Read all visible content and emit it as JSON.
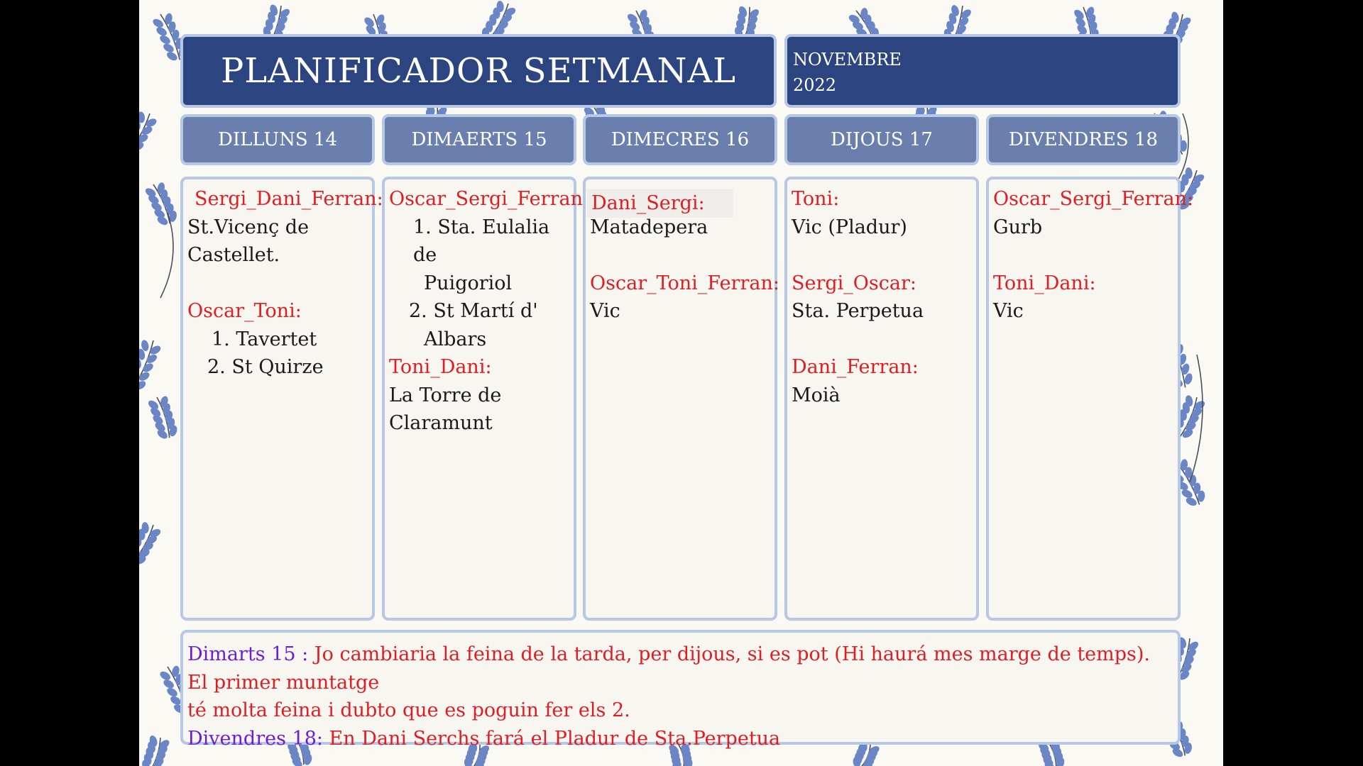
{
  "header": {
    "title": "PLANIFICADOR SETMANAL",
    "month": "NOVEMBRE",
    "year": "2022"
  },
  "days": [
    {
      "label": "DILLUNS 14"
    },
    {
      "label": "DIMAERTS 15"
    },
    {
      "label": "DIMECRES 16"
    },
    {
      "label": "DIJOUS 17"
    },
    {
      "label": "DIVENDRES 18"
    }
  ],
  "schedule": {
    "mon": {
      "g1": "Sergi_Dani_Ferran:",
      "g1_l1": "St.Vicenç de",
      "g1_l2": "Castellet.",
      "g2": "Oscar_Toni:",
      "g2_i1": "1. Tavertet",
      "g2_i2": "2. St Quirze"
    },
    "tue": {
      "g1": "Oscar_Sergi_Ferran:",
      "g1_i1a": "1. Sta. Eulalia de",
      "g1_i1b": "Puigoriol",
      "g1_i2a": "2. St Martí d'",
      "g1_i2b": "Albars",
      "g2": "Toni_Dani:",
      "g2_l1": "La Torre de",
      "g2_l2": "Claramunt"
    },
    "wed": {
      "g1": "Dani_Sergi:",
      "g1_l1": "Matadepera",
      "g2": "Oscar_Toni_Ferran:",
      "g2_l1": "Vic"
    },
    "thu": {
      "g1": "Toni:",
      "g1_l1": "Vic (Pladur)",
      "g2": "Sergi_Oscar:",
      "g2_l1": "Sta. Perpetua",
      "g3": "Dani_Ferran:",
      "g3_l1": "Moià"
    },
    "fri": {
      "g1": "Oscar_Sergi_Ferran:",
      "g1_l1": "Gurb",
      "g2": "Toni_Dani:",
      "g2_l1": "Vic"
    }
  },
  "notes": {
    "n1_label": "Dimarts 15 :",
    "n1_text_a": " Jo cambiaria la feina de la tarda, per dijous, si es pot (Hi haurá mes marge de temps). El primer muntatge",
    "n1_text_b": "té molta feina i dubto que es poguin fer els 2.",
    "n2_label": "Divendres 18:",
    "n2_text": " En Dani Serchs fará el Pladur de Sta.Perpetua"
  },
  "colors": {
    "navy": "#2c4480",
    "slate": "#6b7fae",
    "border": "#b7c7e6",
    "assignee": "#e11d22",
    "note_label": "#6a1fd6",
    "paper": "#fbf9f4"
  },
  "icons": [
    "blue-leaf-branch-pattern"
  ]
}
